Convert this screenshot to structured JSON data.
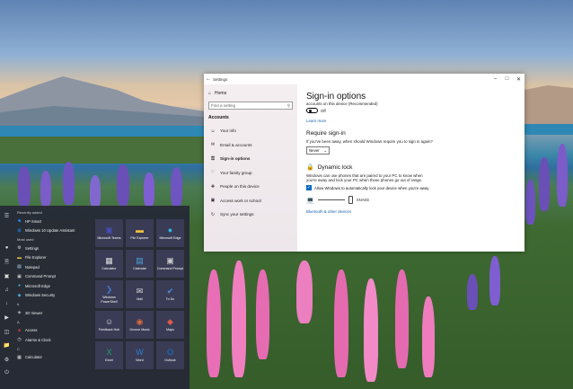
{
  "settings": {
    "window_title": "Settings",
    "nav": {
      "home": "Home",
      "search_placeholder": "Find a setting",
      "section": "Accounts",
      "items": [
        {
          "label": "Your info",
          "icon": "person-icon"
        },
        {
          "label": "Email & accounts",
          "icon": "mail-icon"
        },
        {
          "label": "Sign-in options",
          "icon": "key-icon"
        },
        {
          "label": "Your family group",
          "icon": "family-icon"
        },
        {
          "label": "People on this device",
          "icon": "add-person-icon"
        },
        {
          "label": "Access work or school",
          "icon": "briefcase-icon"
        },
        {
          "label": "Sync your settings",
          "icon": "sync-icon"
        }
      ]
    },
    "content": {
      "title": "Sign-in options",
      "truncated_text": "accounts on this device (Recommended)",
      "toggle_state": "Off",
      "learn_more": "Learn more",
      "require_signin_heading": "Require sign-in",
      "require_signin_question": "If you've been away, when should Windows require you to sign in again?",
      "require_signin_value": "Never",
      "dynamic_lock_heading": "Dynamic lock",
      "dynamic_lock_desc1": "Windows can use phones that are paired to your PC to know when",
      "dynamic_lock_desc2": "you're away and lock your PC when those phones go out of range.",
      "dynamic_lock_checkbox": "Allow Windows to automatically lock your device when you're away",
      "paired_device_label": "SNAKE",
      "bluetooth_link": "Bluetooth & other devices"
    }
  },
  "start_menu": {
    "recently_added_header": "Recently added",
    "recent_apps": [
      {
        "label": "HP Smart",
        "icon": "hp-icon",
        "color": "#1e90ff"
      },
      {
        "label": "Windows 10 Update Assistant",
        "icon": "windows-icon",
        "color": "#1e90ff"
      }
    ],
    "most_used_header": "Most used",
    "most_used_apps": [
      {
        "label": "Settings",
        "icon": "gear-icon",
        "color": "#dddddd"
      },
      {
        "label": "File Explorer",
        "icon": "folder-icon",
        "color": "#f0c040"
      },
      {
        "label": "Notepad",
        "icon": "notepad-icon",
        "color": "#aad4f5"
      },
      {
        "label": "Command Prompt",
        "icon": "command-prompt-icon",
        "color": "#cccccc"
      },
      {
        "label": "Microsoft Edge",
        "icon": "edge-icon",
        "color": "#2fb4e9"
      },
      {
        "label": "Windows Security",
        "icon": "shield-icon",
        "color": "#4aa3df"
      }
    ],
    "hash_header": "#",
    "hash_apps": [
      {
        "label": "3D Viewer",
        "icon": "cube-icon",
        "color": "#bbbbbb"
      }
    ],
    "a_header": "A",
    "a_apps": [
      {
        "label": "Access",
        "icon": "access-icon",
        "color": "#b83b3b"
      },
      {
        "label": "Alarms & Clock",
        "icon": "alarm-icon",
        "color": "#dddddd"
      }
    ],
    "c_header": "C",
    "c_apps": [
      {
        "label": "Calculator",
        "icon": "calculator-icon",
        "color": "#dddddd"
      }
    ],
    "tiles": [
      {
        "label": "Microsoft Teams",
        "icon": "teams-icon",
        "color": "#464eb8",
        "bg": "#3a3c55"
      },
      {
        "label": "File Explorer",
        "icon": "folder-icon",
        "color": "#f0c040",
        "bg": "#3a3c55"
      },
      {
        "label": "Microsoft Edge",
        "icon": "edge-icon",
        "color": "#2fb4e9",
        "bg": "#3a3c55"
      },
      {
        "label": "Calculator",
        "icon": "calculator-icon",
        "color": "#dddddd",
        "bg": "#3a3c55"
      },
      {
        "label": "Calendar",
        "icon": "calendar-icon",
        "color": "#4aa3df",
        "bg": "#3a3c55"
      },
      {
        "label": "Command Prompt",
        "icon": "command-prompt-icon",
        "color": "#cccccc",
        "bg": "#3a3c55"
      },
      {
        "label": "Windows PowerShell",
        "icon": "powershell-icon",
        "color": "#3a78c9",
        "bg": "#3a3c55"
      },
      {
        "label": "Mail",
        "icon": "mail-icon",
        "color": "#dddddd",
        "bg": "#3a3c55"
      },
      {
        "label": "To Do",
        "icon": "todo-icon",
        "color": "#4a8fe0",
        "bg": "#3a3c55"
      },
      {
        "label": "Feedback Hub",
        "icon": "feedback-icon",
        "color": "#dddddd",
        "bg": "#3a3c55"
      },
      {
        "label": "Groove Music",
        "icon": "music-icon",
        "color": "#e06b3a",
        "bg": "#3a3c55"
      },
      {
        "label": "Maps",
        "icon": "maps-icon",
        "color": "#e05a4a",
        "bg": "#3a3c55"
      },
      {
        "label": "Excel",
        "icon": "excel-icon",
        "color": "#21a366",
        "bg": "#3a3c55"
      },
      {
        "label": "Word",
        "icon": "word-icon",
        "color": "#2b7cd3",
        "bg": "#3a3c55"
      },
      {
        "label": "Outlook",
        "icon": "outlook-icon",
        "color": "#0f78d4",
        "bg": "#3a3c55"
      }
    ]
  }
}
